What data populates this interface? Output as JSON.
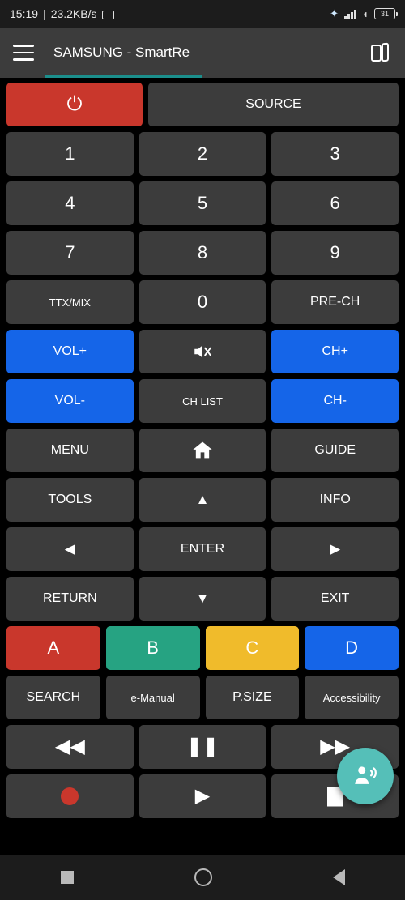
{
  "status_bar": {
    "time": "15:19",
    "separator": "|",
    "network_speed": "23.2KB/s",
    "monitor_icon": "monitor-icon",
    "bluetooth_icon": "bluetooth-icon",
    "signal_icon": "cellular-signal-icon",
    "wifi_icon": "wifi-icon",
    "battery_level": "31"
  },
  "app_bar": {
    "menu_icon": "hamburger-menu-icon",
    "title": "SAMSUNG - SmartRe",
    "cards_icon": "switch-remote-icon"
  },
  "remote": {
    "rows": [
      [
        {
          "name": "power-button",
          "label": "⏻",
          "style": "power",
          "size": "glyph"
        },
        {
          "name": "source-button",
          "label": "SOURCE",
          "style": "",
          "size": "med"
        }
      ],
      [
        {
          "name": "key-1-button",
          "label": "1",
          "style": "",
          "size": ""
        },
        {
          "name": "key-2-button",
          "label": "2",
          "style": "",
          "size": ""
        },
        {
          "name": "key-3-button",
          "label": "3",
          "style": "",
          "size": ""
        }
      ],
      [
        {
          "name": "key-4-button",
          "label": "4",
          "style": "",
          "size": ""
        },
        {
          "name": "key-5-button",
          "label": "5",
          "style": "",
          "size": ""
        },
        {
          "name": "key-6-button",
          "label": "6",
          "style": "",
          "size": ""
        }
      ],
      [
        {
          "name": "key-7-button",
          "label": "7",
          "style": "",
          "size": ""
        },
        {
          "name": "key-8-button",
          "label": "8",
          "style": "",
          "size": ""
        },
        {
          "name": "key-9-button",
          "label": "9",
          "style": "",
          "size": ""
        }
      ],
      [
        {
          "name": "ttx-mix-button",
          "label": "TTX/MIX",
          "style": "",
          "size": "small"
        },
        {
          "name": "key-0-button",
          "label": "0",
          "style": "",
          "size": ""
        },
        {
          "name": "pre-ch-button",
          "label": "PRE-CH",
          "style": "",
          "size": "med"
        }
      ],
      [
        {
          "name": "volume-up-button",
          "label": "VOL+",
          "style": "blue",
          "size": "med"
        },
        {
          "name": "mute-button",
          "label": "MUTE",
          "style": "",
          "size": "icon-mute"
        },
        {
          "name": "channel-up-button",
          "label": "CH+",
          "style": "blue",
          "size": "med"
        }
      ],
      [
        {
          "name": "volume-down-button",
          "label": "VOL-",
          "style": "blue",
          "size": "med"
        },
        {
          "name": "channel-list-button",
          "label": "CH LIST",
          "style": "",
          "size": "small"
        },
        {
          "name": "channel-down-button",
          "label": "CH-",
          "style": "blue",
          "size": "med"
        }
      ],
      [
        {
          "name": "menu-button",
          "label": "MENU",
          "style": "",
          "size": "med"
        },
        {
          "name": "home-button",
          "label": "HOME",
          "style": "",
          "size": "icon-home"
        },
        {
          "name": "guide-button",
          "label": "GUIDE",
          "style": "",
          "size": "med"
        }
      ],
      [
        {
          "name": "tools-button",
          "label": "TOOLS",
          "style": "",
          "size": "med"
        },
        {
          "name": "dpad-up-button",
          "label": "▲",
          "style": "",
          "size": "glyph-sm"
        },
        {
          "name": "info-button",
          "label": "INFO",
          "style": "",
          "size": "med"
        }
      ],
      [
        {
          "name": "dpad-left-button",
          "label": "◀",
          "style": "",
          "size": "glyph-sm"
        },
        {
          "name": "enter-button",
          "label": "ENTER",
          "style": "",
          "size": "med"
        },
        {
          "name": "dpad-right-button",
          "label": "▶",
          "style": "",
          "size": "glyph-sm"
        }
      ],
      [
        {
          "name": "return-button",
          "label": "RETURN",
          "style": "",
          "size": "med"
        },
        {
          "name": "dpad-down-button",
          "label": "▼",
          "style": "",
          "size": "glyph-sm"
        },
        {
          "name": "exit-button",
          "label": "EXIT",
          "style": "",
          "size": "med"
        }
      ],
      [
        {
          "name": "color-a-button",
          "label": "A",
          "style": "red",
          "size": ""
        },
        {
          "name": "color-b-button",
          "label": "B",
          "style": "green",
          "size": ""
        },
        {
          "name": "color-c-button",
          "label": "C",
          "style": "yellow",
          "size": ""
        },
        {
          "name": "color-d-button",
          "label": "D",
          "style": "blue",
          "size": ""
        }
      ],
      [
        {
          "name": "search-button",
          "label": "SEARCH",
          "style": "",
          "size": "med"
        },
        {
          "name": "e-manual-button",
          "label": "e-Manual",
          "style": "",
          "size": "small"
        },
        {
          "name": "p-size-button",
          "label": "P.SIZE",
          "style": "",
          "size": "med"
        },
        {
          "name": "accessibility-button",
          "label": "Accessibility",
          "style": "",
          "size": "small"
        }
      ],
      [
        {
          "name": "rewind-button",
          "label": "◀◀",
          "style": "",
          "size": "glyph"
        },
        {
          "name": "pause-button",
          "label": "❚❚",
          "style": "",
          "size": "glyph"
        },
        {
          "name": "fast-forward-button",
          "label": "▶▶",
          "style": "",
          "size": "glyph"
        }
      ],
      [
        {
          "name": "record-button",
          "label": "RECORD",
          "style": "",
          "size": "icon-record"
        },
        {
          "name": "play-button",
          "label": "▶",
          "style": "",
          "size": "glyph"
        },
        {
          "name": "stop-page-button",
          "label": "PAGE",
          "style": "",
          "size": "icon-page"
        }
      ]
    ],
    "voice_button": "voice-assistant-icon"
  },
  "nav_bar": {
    "recents_icon": "recents-square-icon",
    "home_icon": "home-circle-icon",
    "back_icon": "back-triangle-icon"
  },
  "colors": {
    "accent": "#1b8f8c",
    "power_red": "#c9372c",
    "blue": "#1565e8",
    "green": "#26a382",
    "yellow": "#f0bb2b",
    "button_grey": "#3c3c3c",
    "fab": "#55bfb8"
  }
}
